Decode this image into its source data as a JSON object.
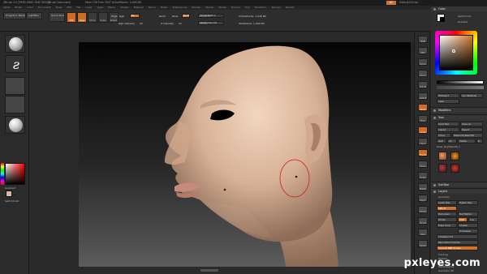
{
  "titlebar": {
    "app_title": "ZBrush 4.0 [FREE-MIKE-7D4F-9DC1]",
    "document": "ZBrush Document",
    "stats": "Mem 728 Free 2937 ActivePoints: 1.048 Mil",
    "ai_button": "AC",
    "default_script": "DefaultZScript"
  },
  "menubar": {
    "items": [
      "Alpha",
      "Brush",
      "Color",
      "Document",
      "Draw",
      "Edit",
      "File",
      "Layer",
      "Light",
      "Macro",
      "Marker",
      "Material",
      "Movie",
      "Picker",
      "Preferences",
      "Render",
      "Stencil",
      "Stroke",
      "Texture",
      "Tool",
      "Transform",
      "Zplugin",
      "Zscript"
    ]
  },
  "toolbar": {
    "projection_master": "Projection Master",
    "lightbox": "LightBox",
    "quick_sketch": "Quick Sketch",
    "edit": "Edit",
    "draw": "Draw",
    "move": "Move",
    "scale": "Scale",
    "rotate": "Rotate",
    "mrgb": "Mrgb",
    "rgb": "Rgb",
    "m": "M",
    "rgb_intensity_label": "Rgb Intensity",
    "rgb_intensity": "25",
    "zadd": "Zadd",
    "zsub": "Zsub",
    "zcut": "Zcut",
    "z_intensity_label": "Z Intensity",
    "z_intensity": "12",
    "focal_shift_label": "Focal Shift",
    "focal_shift": "0",
    "draw_size_label": "Draw Size",
    "draw_size": "64",
    "active_points": "ActivePoints: 1.048 Mil",
    "total_points": "TotalPoints: 1.049 Mil"
  },
  "left_shelf": {
    "gradient_label": "Gradient",
    "switch_color_label": "SwitchColor",
    "skin_color": "#d9b9a0"
  },
  "right_shelf": {
    "buttons": [
      "BPR",
      "SPix",
      "Scroll",
      "Zoom",
      "Actual",
      "AAHalf",
      "Persp",
      "Floor",
      "Local",
      "LSym",
      "Frame",
      "Move",
      "Scale",
      "Rotate",
      "PolyF",
      "Transp",
      "Ghost",
      "Solo",
      "Xpose"
    ]
  },
  "tray": {
    "color_header": "Color",
    "switch_color": "SwitchColor",
    "gradient": "Gradient",
    "fill_object": "FillObject",
    "sync_mat": "SyncMaterial",
    "clear": "Clear",
    "modifiers": "Modifiers",
    "tool_header": "Tool",
    "load_tool": "Load Tool",
    "save_as": "Save As",
    "import": "Import",
    "export": "Export",
    "clone": "Clone",
    "make_polymesh3d": "Make PolyMesh3D",
    "goz": "GoZ",
    "all": "All",
    "visible": "Visible",
    "r": "R",
    "tool_name": "Head_PolyMesh3D_1",
    "subtool": "SubTool",
    "layers": "Layers",
    "geometry": "Geometry",
    "lower_res": "Lower Res",
    "higher_res": "Higher Res",
    "sdiv": "SDiv 6",
    "del_lower": "Del Lower",
    "del_higher": "Del Higher",
    "divide": "Divide",
    "smt": "Smt",
    "suv": "Suv",
    "edge_loop": "Edge Loop",
    "crease": "Crease",
    "uncrease": "UnCrease",
    "creaselvl": "CreaseLvl 15",
    "reconstruct": "Reconstruct Subdiv",
    "convert_bpr": "Convert BPR To Geo",
    "topology": "Topology",
    "position": "Position",
    "size": "Size",
    "mesh_integrity": "MeshIntegrity",
    "geometry_hd": "Geometry HD",
    "preview": "Preview",
    "surface": "Surface"
  },
  "watermark": {
    "text": "pxleyes.com"
  }
}
